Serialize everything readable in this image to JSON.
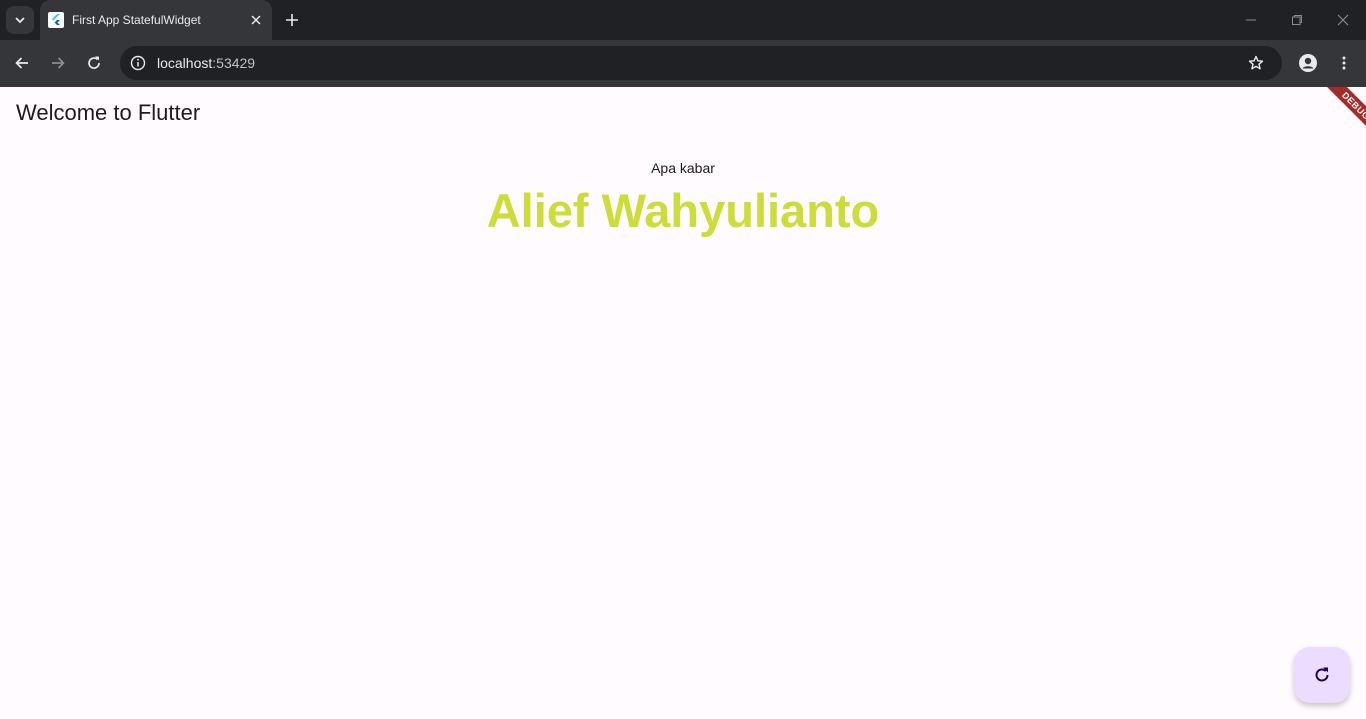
{
  "browser": {
    "tab_title": "First App StatefulWidget",
    "url_host": "localhost",
    "url_port": ":53429"
  },
  "app": {
    "appbar_title": "Welcome to Flutter",
    "greeting": "Apa kabar",
    "name": "Alief Wahyulianto",
    "debug_banner": "DEBUG",
    "fab_icon": "refresh-icon"
  },
  "colors": {
    "name_color": "#cddc39",
    "fab_background": "#eaddff",
    "app_background": "#fffbfe",
    "debug_banner": "#a52a2a"
  }
}
